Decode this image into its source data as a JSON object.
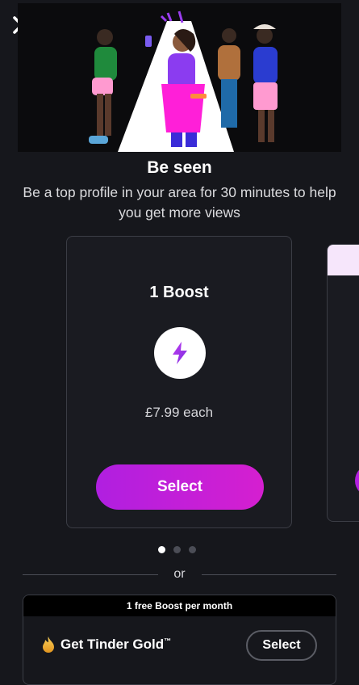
{
  "header": {
    "close_icon": "close-icon"
  },
  "hero": {
    "title": "Be seen",
    "subtitle": "Be a top profile in your area for 30 minutes to help you get more views"
  },
  "carousel": {
    "cards": [
      {
        "title": "1 Boost",
        "icon": "lightning-bolt-icon",
        "price": "£7.99 each",
        "select_label": "Select"
      }
    ],
    "page_count": 3,
    "active_index": 0
  },
  "divider": {
    "label": "or"
  },
  "gold": {
    "banner": "1 free Boost per month",
    "icon": "flame-icon",
    "name": "Get Tinder Gold",
    "trademark": "™",
    "select_label": "Select"
  },
  "colors": {
    "background": "#16171c",
    "accent_purple": "#b01fe0",
    "accent_magenta": "#d51fd0",
    "gold": "#f0b23a"
  }
}
